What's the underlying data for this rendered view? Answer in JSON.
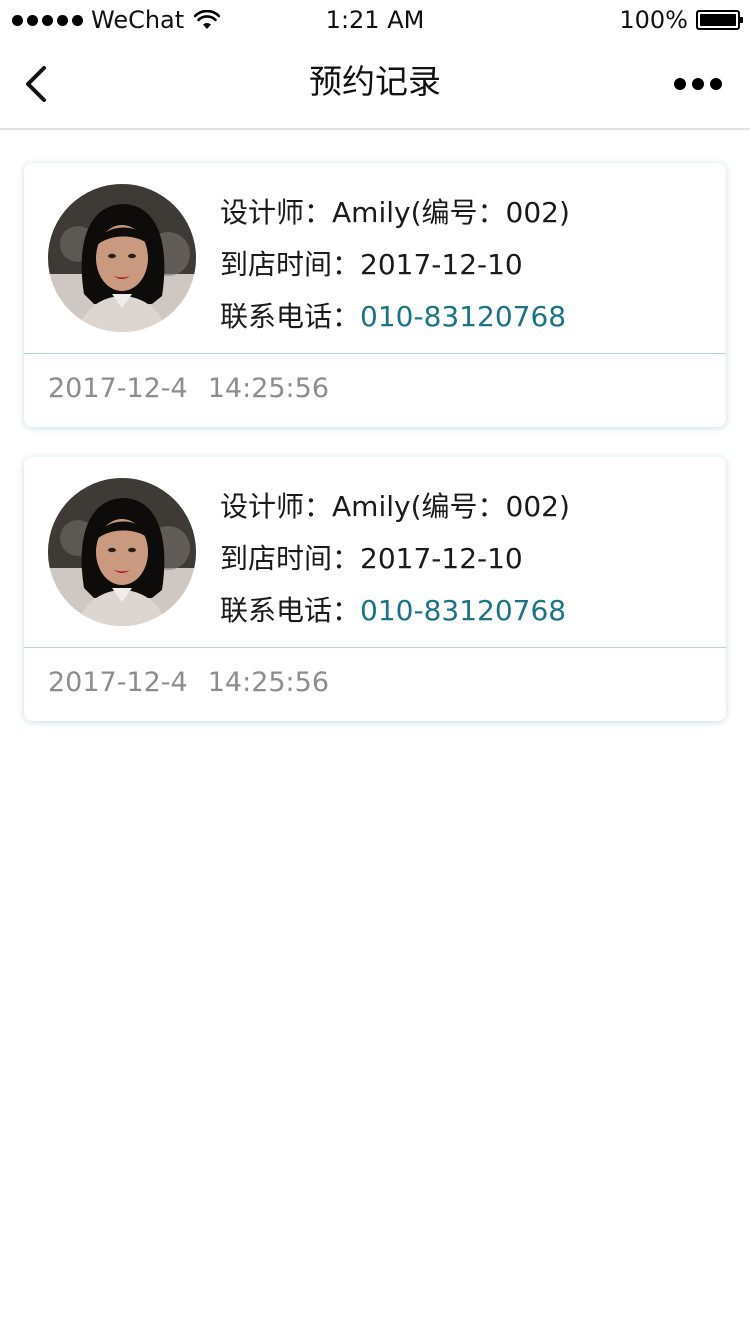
{
  "status_bar": {
    "carrier": "WeChat",
    "time": "1:21 AM",
    "battery": "100%"
  },
  "nav": {
    "title": "预约记录"
  },
  "records": [
    {
      "designer_label": "设计师：",
      "designer_name": "Amily(编号：002)",
      "visit_label": "到店时间：",
      "visit_date": "2017-12-10",
      "phone_label": "联系电话：",
      "phone": "010-83120768",
      "created_date": "2017-12-4",
      "created_time": "14:25:56"
    },
    {
      "designer_label": "设计师：",
      "designer_name": "Amily(编号：002)",
      "visit_label": "到店时间：",
      "visit_date": "2017-12-10",
      "phone_label": "联系电话：",
      "phone": "010-83120768",
      "created_date": "2017-12-4",
      "created_time": "14:25:56"
    }
  ],
  "colors": {
    "phone": "#1b7486",
    "timestamp": "#8d8d8d",
    "divider": "#b9d4dc"
  }
}
